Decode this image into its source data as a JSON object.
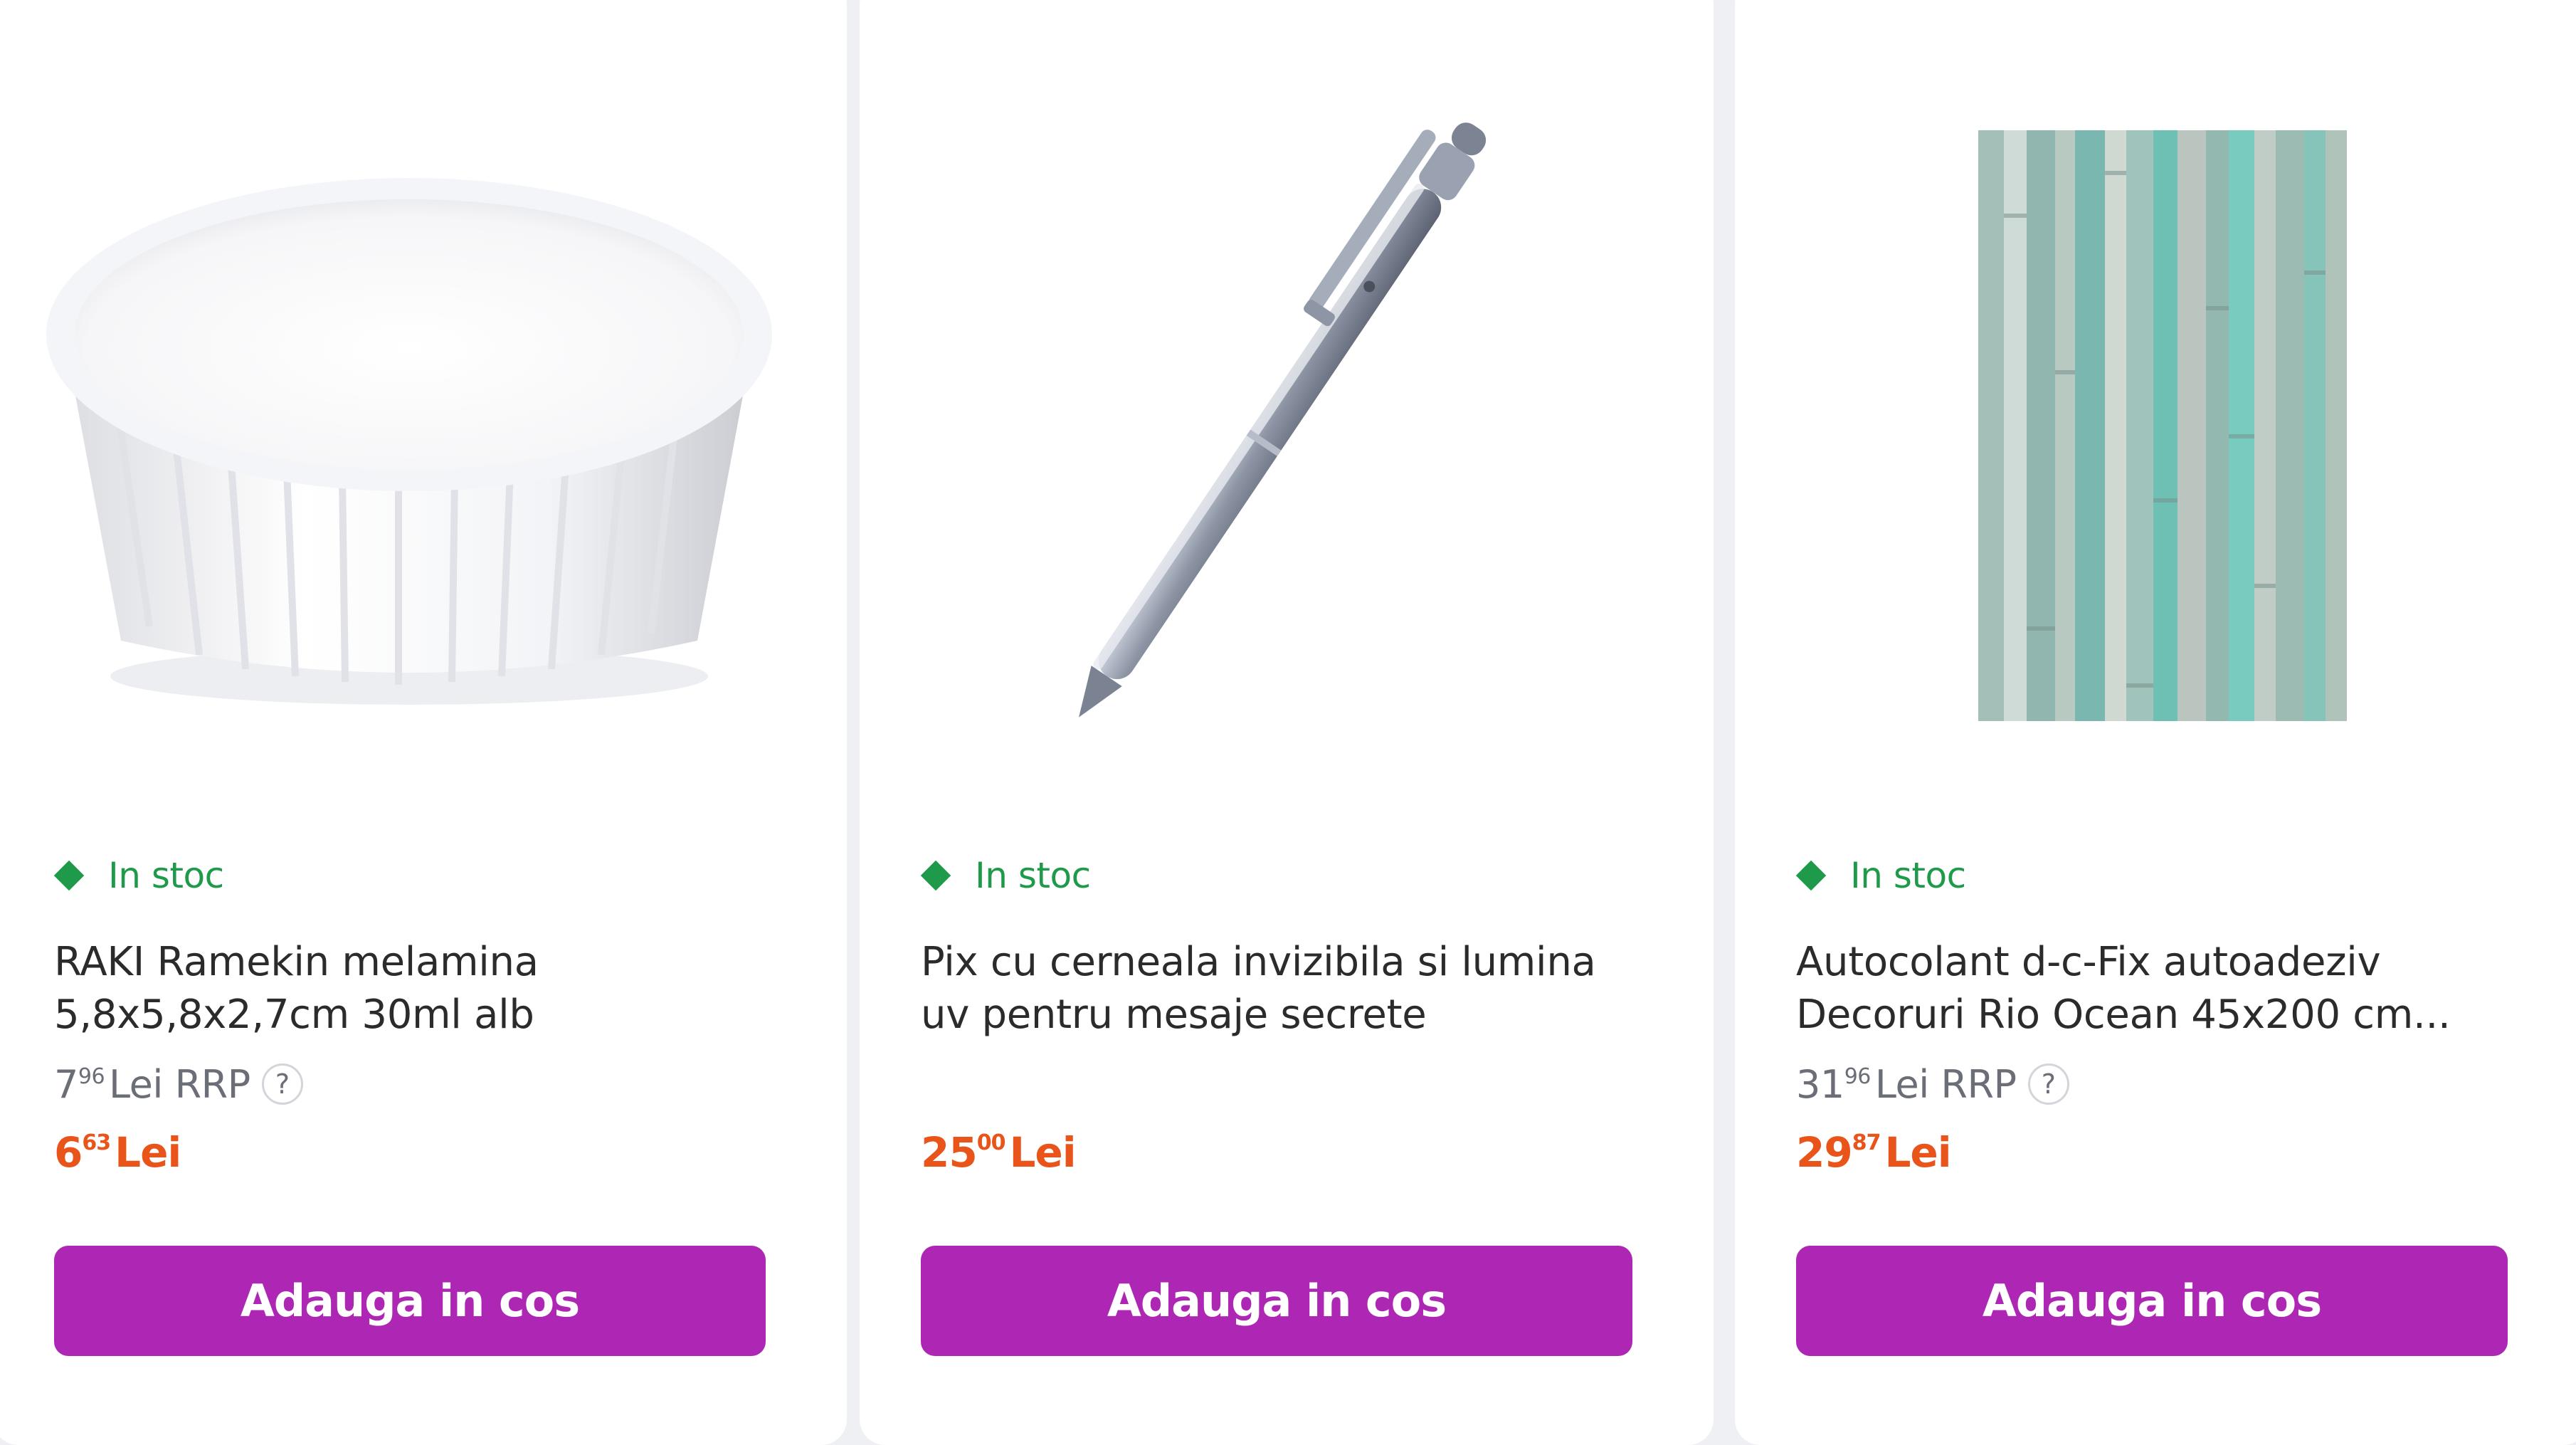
{
  "products": [
    {
      "stock": "In stoc",
      "title_lines": [
        "RAKI Ramekin melamina",
        "5,8x5,8x2,7cm 30ml alb"
      ],
      "rrp_int": "7",
      "rrp_dec": "96",
      "rrp_label": "Lei RRP",
      "rrp_help": "?",
      "price_int": "6",
      "price_dec": "63",
      "price_currency": "Lei",
      "button": "Adauga in cos",
      "image_icon": "ramekin-image"
    },
    {
      "stock": "In stoc",
      "title_lines": [
        "Pix cu cerneala invizibila si lumina",
        "uv pentru mesaje secrete"
      ],
      "price_int": "25",
      "price_dec": "00",
      "price_currency": "Lei",
      "button": "Adauga in cos",
      "image_icon": "pen-image"
    },
    {
      "stock": "In stoc",
      "title_lines": [
        "Autocolant d-c-Fix autoadeziv",
        "Decoruri Rio Ocean 45x200 cm..."
      ],
      "rrp_int": "31",
      "rrp_dec": "96",
      "rrp_label": "Lei RRP",
      "rrp_help": "?",
      "price_int": "29",
      "price_dec": "87",
      "price_currency": "Lei",
      "button": "Adauga in cos",
      "image_icon": "wood-foil-image"
    }
  ],
  "colors": {
    "stock_green": "#1f9a4b",
    "price_orange": "#e8541a",
    "button_purple": "#ad27b4"
  }
}
